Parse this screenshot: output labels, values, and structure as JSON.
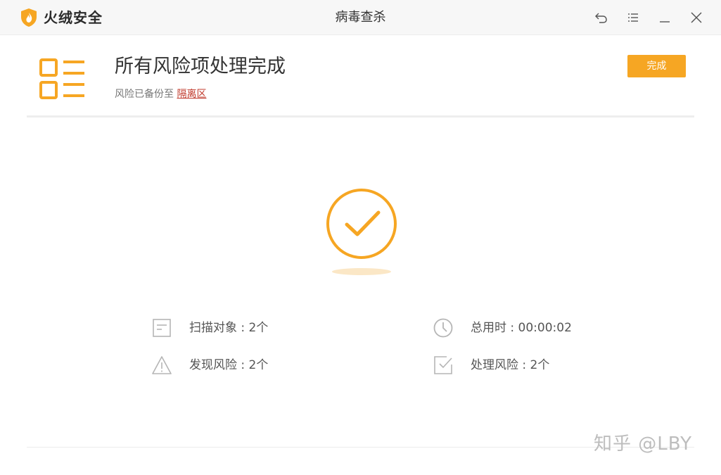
{
  "app": {
    "brand": "火绒安全",
    "window_title": "病毒查杀"
  },
  "titlebar_icons": [
    "back-icon",
    "menu-icon",
    "minimize-icon",
    "close-icon"
  ],
  "header": {
    "headline": "所有风险项处理完成",
    "sub_prefix": "风险已备份至",
    "sub_link": "隔离区",
    "done_label": "完成"
  },
  "stats": {
    "scan_objects": "扫描对象 : 2个",
    "total_time": "总用时 : 00:00:02",
    "risks_found": "发现风险 : 2个",
    "risks_handled": "处理风险 : 2个"
  },
  "watermark": "知乎 @LBY",
  "colors": {
    "accent": "#f6a623",
    "link": "#c0392b",
    "icon_gray": "#b5b5b5"
  }
}
